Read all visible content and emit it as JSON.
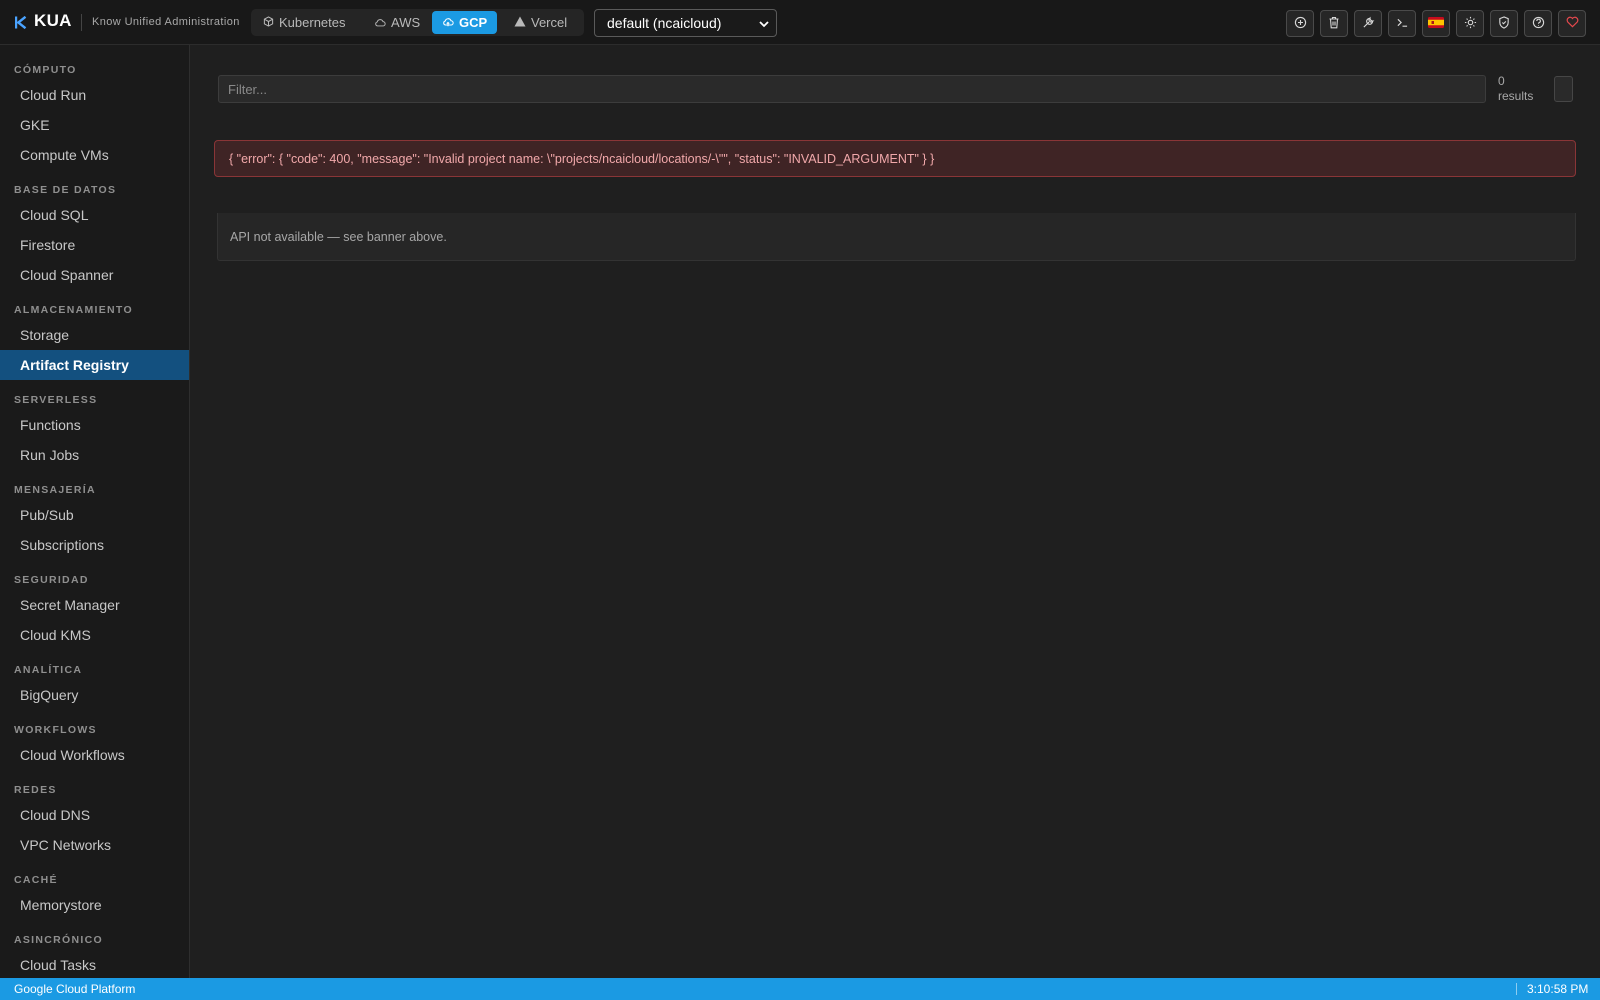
{
  "app": {
    "brand": "KUA",
    "tagline": "Know Unified Administration"
  },
  "providers": [
    {
      "label": "Kubernetes",
      "icon": "cube-icon",
      "active": false
    },
    {
      "label": "AWS",
      "icon": "cloud-icon",
      "active": false
    },
    {
      "label": "GCP",
      "icon": "cloud-upload-icon",
      "active": true
    },
    {
      "label": "Vercel",
      "icon": "triangle-icon",
      "active": false
    }
  ],
  "profile": {
    "selected": "default (ncaicloud)"
  },
  "toolbar": {
    "icons": [
      "plus-circle-icon",
      "trash-icon",
      "wrench-icon",
      "terminal-icon",
      "spain-flag-icon",
      "sun-icon",
      "shield-icon",
      "help-icon",
      "heart-icon"
    ]
  },
  "sidebar": {
    "sections": [
      {
        "title": "CÓMPUTO",
        "items": [
          "Cloud Run",
          "GKE",
          "Compute VMs"
        ]
      },
      {
        "title": "BASE DE DATOS",
        "items": [
          "Cloud SQL",
          "Firestore",
          "Cloud Spanner"
        ]
      },
      {
        "title": "ALMACENAMIENTO",
        "items": [
          "Storage",
          "Artifact Registry"
        ]
      },
      {
        "title": "SERVERLESS",
        "items": [
          "Functions",
          "Run Jobs"
        ]
      },
      {
        "title": "MENSAJERÍA",
        "items": [
          "Pub/Sub",
          "Subscriptions"
        ]
      },
      {
        "title": "SEGURIDAD",
        "items": [
          "Secret Manager",
          "Cloud KMS"
        ]
      },
      {
        "title": "ANALÍTICA",
        "items": [
          "BigQuery"
        ]
      },
      {
        "title": "WORKFLOWS",
        "items": [
          "Cloud Workflows"
        ]
      },
      {
        "title": "REDES",
        "items": [
          "Cloud DNS",
          "VPC Networks"
        ]
      },
      {
        "title": "CACHÉ",
        "items": [
          "Memorystore"
        ]
      },
      {
        "title": "ASINCRÓNICO",
        "items": [
          "Cloud Tasks"
        ]
      }
    ],
    "active_item": "Artifact Registry"
  },
  "filter": {
    "placeholder": "Filter...",
    "value": ""
  },
  "results": {
    "count": "0",
    "label": "results"
  },
  "error": {
    "message": "{ \"error\": { \"code\": 400, \"message\": \"Invalid project name: \\\"projects/ncaicloud/locations/-\\\"\", \"status\": \"INVALID_ARGUMENT\" } }"
  },
  "empty_state": {
    "message": "API not available — see banner above."
  },
  "status_bar": {
    "provider": "Google Cloud Platform",
    "time": "3:10:58 PM"
  },
  "colors": {
    "accent": "#1b9ae3",
    "active_nav": "#13507f",
    "error_bg": "#3f2425",
    "error_border": "#8a3537",
    "error_text": "#f1a8aa",
    "heart": "#e5484d"
  }
}
